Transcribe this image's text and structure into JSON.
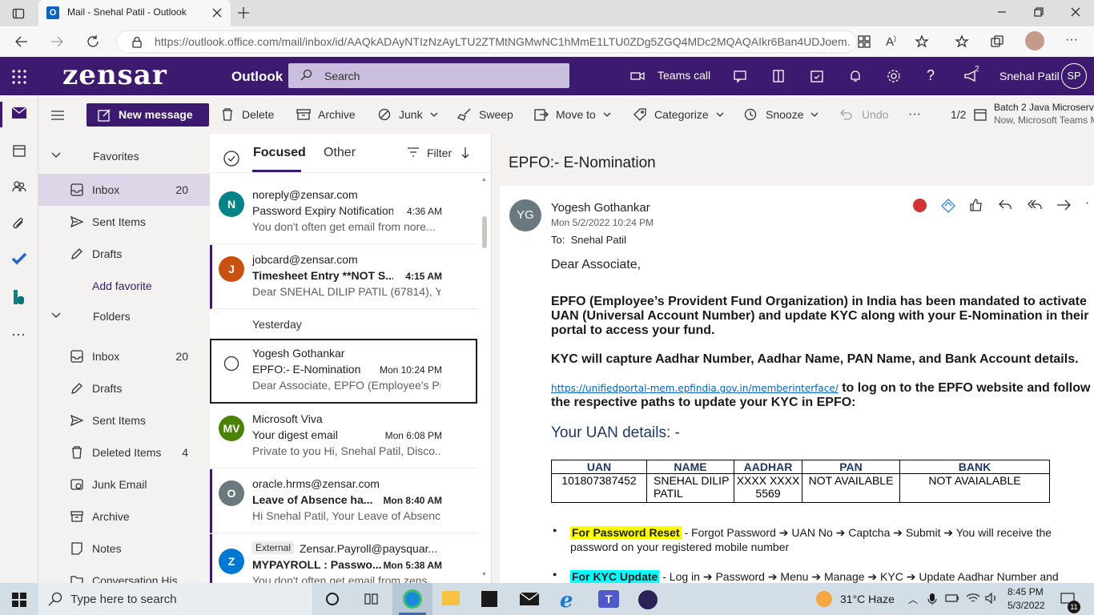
{
  "browser": {
    "tab_title": "Mail - Snehal Patil - Outlook",
    "url": "https://outlook.office.com/mail/inbox/id/AAQkADAyNTIzNzAyLTU2ZTMtNGMwNC1hMmE1LTU0ZDg5ZGQ4MDc2MQAQAIkr6Ban4UDJoem..."
  },
  "header": {
    "brand": "zensar",
    "app_name": "Outlook",
    "search_placeholder": "Search",
    "teams_call": "Teams call",
    "notif_count": "2",
    "user_name": "Snehal Patil",
    "user_initials": "SP"
  },
  "toolbar": {
    "new_message": "New message",
    "delete": "Delete",
    "archive": "Archive",
    "junk": "Junk",
    "sweep": "Sweep",
    "move_to": "Move to",
    "categorize": "Categorize",
    "snooze": "Snooze",
    "undo": "Undo",
    "more": "···",
    "reminder_count": "1/2",
    "reminder_title": "Batch 2 Java Microserv",
    "reminder_sub": "Now, Microsoft Teams M"
  },
  "folders": {
    "favorites_label": "Favorites",
    "folders_label": "Folders",
    "add_favorite": "Add favorite",
    "favorites": [
      {
        "label": "Inbox",
        "count": "20"
      },
      {
        "label": "Sent Items",
        "count": ""
      },
      {
        "label": "Drafts",
        "count": ""
      }
    ],
    "items": [
      {
        "label": "Inbox",
        "count": "20"
      },
      {
        "label": "Drafts",
        "count": ""
      },
      {
        "label": "Sent Items",
        "count": ""
      },
      {
        "label": "Deleted Items",
        "count": "4"
      },
      {
        "label": "Junk Email",
        "count": ""
      },
      {
        "label": "Archive",
        "count": ""
      },
      {
        "label": "Notes",
        "count": ""
      },
      {
        "label": "Conversation His",
        "count": ""
      }
    ]
  },
  "list": {
    "tab_focused": "Focused",
    "tab_other": "Other",
    "filter": "Filter",
    "group_yesterday": "Yesterday",
    "messages": [
      {
        "initials": "N",
        "color": "#038387",
        "sender": "noreply@zensar.com",
        "subject": "Password Expiry Notification",
        "time": "4:36 AM",
        "preview": "You don't often get email from nore..."
      },
      {
        "initials": "J",
        "color": "#ca5010",
        "sender": "jobcard@zensar.com",
        "subject": "Timesheet Entry **NOT S...",
        "time": "4:15 AM",
        "preview": "Dear SNEHAL DILIP PATIL (67814), Y..."
      },
      {
        "initials": "",
        "color": "",
        "sender": "Yogesh Gothankar",
        "subject": "EPFO:- E-Nomination",
        "time": "Mon 10:24 PM",
        "preview": "Dear Associate, EPFO (Employee's Pr..."
      },
      {
        "initials": "MV",
        "color": "#498205",
        "sender": "Microsoft Viva",
        "subject": "Your digest email",
        "time": "Mon 6:08 PM",
        "preview": "Private to you Hi, Snehal Patil, Disco..."
      },
      {
        "initials": "O",
        "color": "#69797e",
        "sender": "oracle.hrms@zensar.com",
        "subject": "Leave of Absence ha...",
        "time": "Mon 8:40 AM",
        "preview": "Hi Snehal Patil, Your Leave of Absenc..."
      },
      {
        "initials": "Z",
        "color": "#0078d4",
        "external": "External",
        "sender": "Zensar.Payroll@paysquar...",
        "subject": "MYPAYROLL : Passwo...",
        "time": "Mon 5:38 AM",
        "preview": "You don't often get email from zens..."
      }
    ]
  },
  "reading": {
    "subject": "EPFO:- E-Nomination",
    "sender_initials": "YG",
    "sender_name": "Yogesh Gothankar",
    "date": "Mon 5/2/2022 10:24 PM",
    "to_label": "To:",
    "to": "Snehal Patil",
    "greeting": "Dear Associate,",
    "para1": "EPFO (Employee’s Provident Fund Organization) in India has been mandated to activate UAN (Universal Account Number) and update KYC along with your E-Nomination in their portal to access your fund.",
    "para2": "KYC will capture Aadhar Number, Aadhar Name, PAN Name, and Bank Account details.",
    "link": "https://unifiedportal-mem.epfindia.gov.in/memberinterface/",
    "para3": " to log on to the EPFO website and follow the respective paths to update your KYC in EPFO:",
    "uan_heading": "Your UAN details: -",
    "table_headers": [
      "UAN",
      "NAME",
      "AADHAR",
      "PAN",
      "BANK"
    ],
    "table_row": [
      "101807387452",
      "SNEHAL DILIP PATIL",
      "XXXX XXXX 5569",
      "NOT AVAILABLE",
      "NOT AVAIALABLE"
    ],
    "bullet1_label": "For Password Reset",
    "bullet1_text": " - Forgot Password ➔ UAN No ➔ Captcha ➔  Submit ➔ You will receive the password on your registered mobile number",
    "bullet2_label": "For KYC Update",
    "bullet2_text": " - Log in ➔ Password ➔ Menu ➔ Manage ➔  KYC ➔ Update Aadhar Number and"
  },
  "taskbar": {
    "search_placeholder": "Type here to search",
    "weather": "31°C  Haze",
    "time": "8:45 PM",
    "date": "5/3/2022",
    "notif_count": "11"
  },
  "colors": {
    "brand": "#3b1a70",
    "accent": "#5c2d91"
  }
}
